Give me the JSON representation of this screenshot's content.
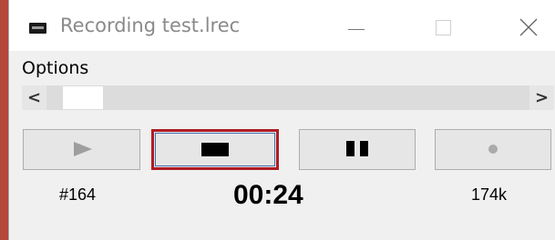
{
  "window": {
    "title": "Recording test.lrec",
    "icon": "app-window-icon"
  },
  "titlebar_buttons": [
    "minimize-icon",
    "maximize-icon",
    "close-icon"
  ],
  "menu": {
    "items": [
      "Options"
    ]
  },
  "scrollbar": {
    "left_arrow": "<",
    "right_arrow": ">"
  },
  "transport": {
    "buttons": [
      {
        "name": "play",
        "icon": "play-icon",
        "enabled": false
      },
      {
        "name": "stop",
        "icon": "stop-icon",
        "enabled": true,
        "focused": true
      },
      {
        "name": "pause",
        "icon": "pause-icon",
        "enabled": true
      },
      {
        "name": "record",
        "icon": "record-icon",
        "enabled": false
      }
    ],
    "highlight_color": "#b01c22"
  },
  "status": {
    "take": "#164",
    "elapsed": "00:24",
    "size": "174k"
  }
}
